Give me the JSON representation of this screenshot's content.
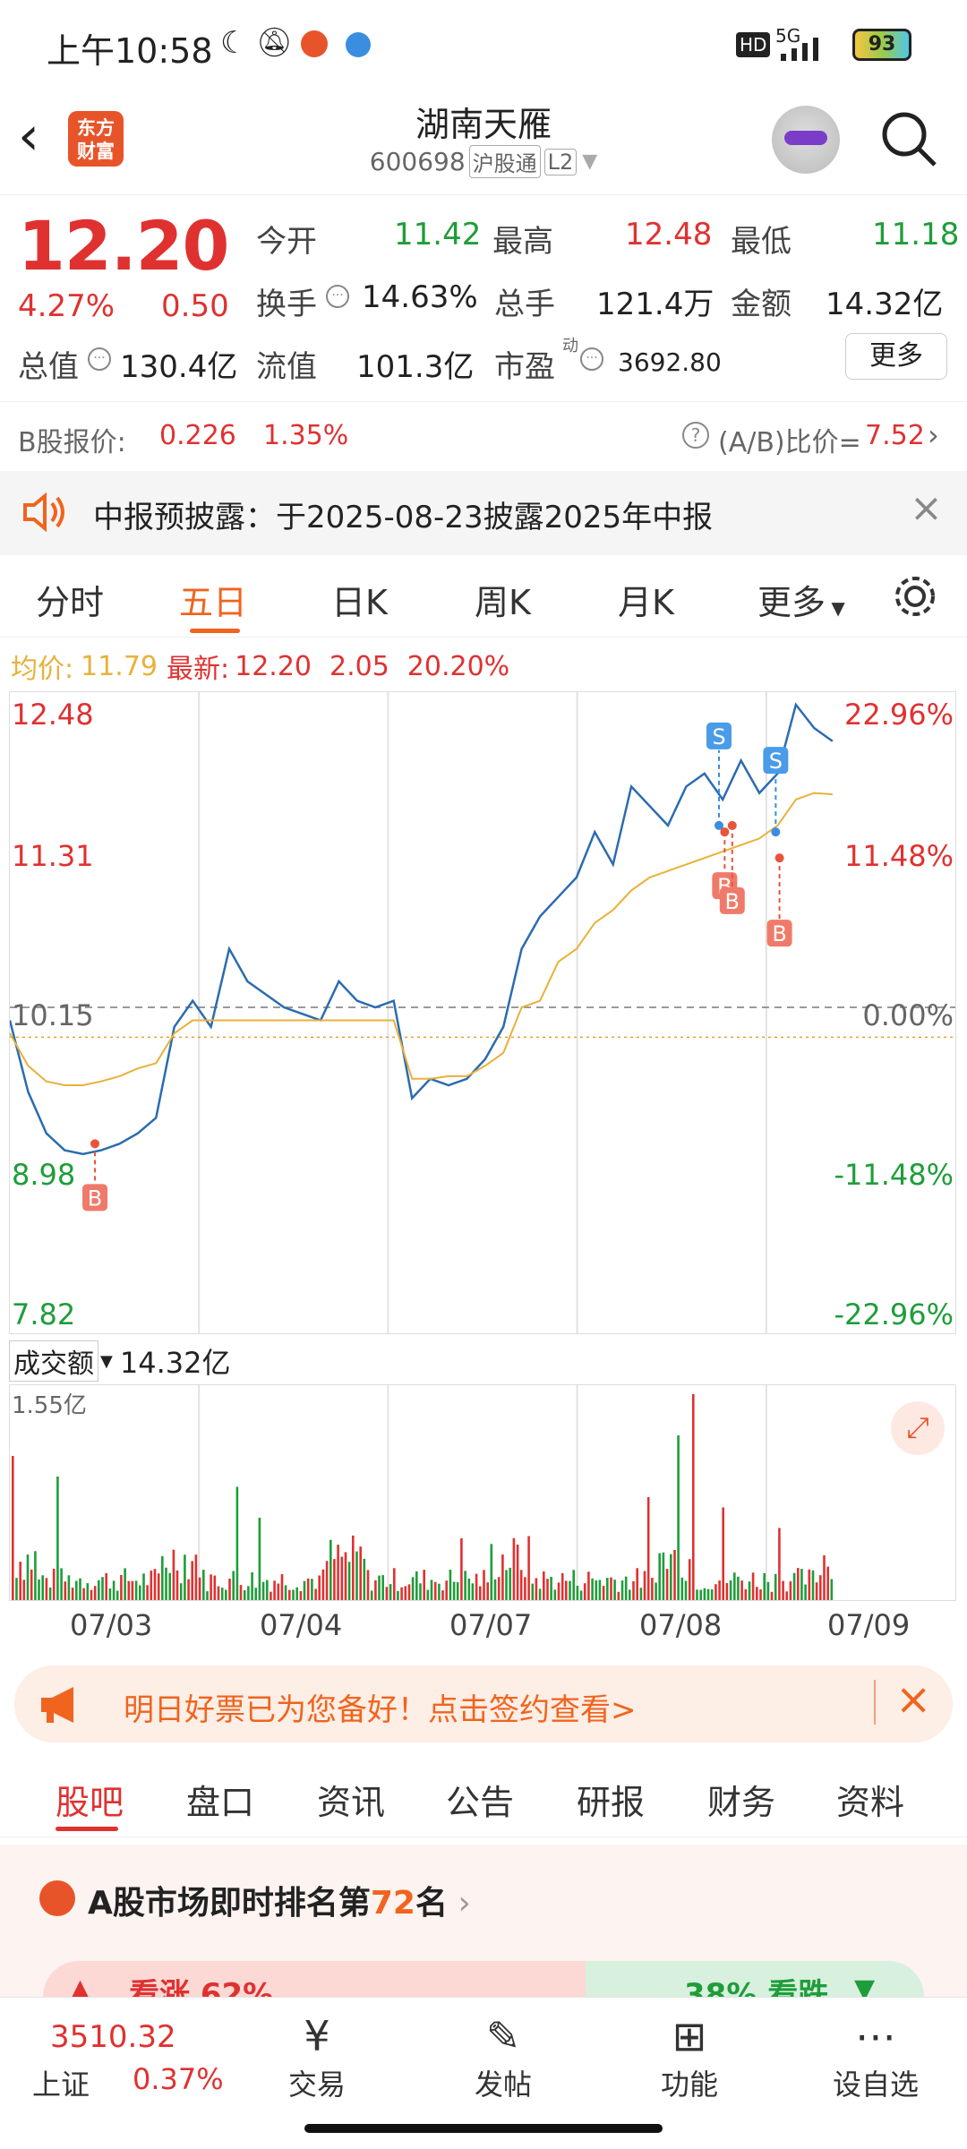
{
  "status_bar": {
    "time": "上午10:58",
    "network": "5G",
    "battery": "93"
  },
  "header": {
    "app_logo_text": "东方财富",
    "stock_name": "湖南天雁",
    "stock_code": "600698",
    "tag_hgt": "沪股通",
    "tag_l2": "L2"
  },
  "quote": {
    "price": "12.20",
    "change_pct": "4.27%",
    "change": "0.50",
    "fields": {
      "open_label": "今开",
      "open": "11.42",
      "high_label": "最高",
      "high": "12.48",
      "low_label": "最低",
      "low": "11.18",
      "turnover_label": "换手",
      "turnover": "14.63%",
      "volume_label": "总手",
      "volume": "121.4万",
      "amount_label": "金额",
      "amount": "14.32亿",
      "mktcap_label": "总值",
      "mktcap": "130.4亿",
      "float_label": "流值",
      "float": "101.3亿",
      "pe_label": "市盈",
      "pe_sup": "动",
      "pe": "3692.80"
    },
    "more_label": "更多"
  },
  "b_share": {
    "label": "B股报价:",
    "price": "0.226",
    "pct": "1.35%",
    "ratio_label": "(A/B)比价=",
    "ratio": "7.52"
  },
  "notice": {
    "text": "中报预披露：于2025-08-23披露2025年中报"
  },
  "chart_tabs": [
    "分时",
    "五日",
    "日K",
    "周K",
    "月K",
    "更多"
  ],
  "legend": {
    "avg_label": "均价:",
    "avg": "11.79",
    "latest_label": "最新:",
    "latest": "12.20",
    "chg": "2.05",
    "chg_pct": "20.20%"
  },
  "chart_data": {
    "type": "line",
    "title": "",
    "x": [
      "07/03",
      "07/04",
      "07/07",
      "07/08",
      "07/09"
    ],
    "ylim": [
      7.82,
      12.48
    ],
    "y_ticks_left": [
      "12.48",
      "11.31",
      "10.15",
      "8.98",
      "7.82"
    ],
    "y_ticks_right": [
      "22.96%",
      "11.48%",
      "0.00%",
      "-11.48%",
      "-22.96%"
    ],
    "series": [
      {
        "name": "",
        "color": "#2b6cb0",
        "values": [
          10.05,
          9.5,
          9.18,
          9.05,
          9.02,
          9.05,
          9.1,
          9.18,
          9.3,
          10.0,
          10.2,
          10.0,
          10.6,
          10.35,
          10.25,
          10.15,
          10.1,
          10.05,
          10.35,
          10.2,
          10.15,
          10.2,
          9.45,
          9.6,
          9.55,
          9.6,
          9.75,
          10.0,
          10.6,
          10.85,
          11.0,
          11.15,
          11.5,
          11.25,
          11.85,
          11.7,
          11.55,
          11.85,
          11.95,
          11.75,
          12.05,
          11.8,
          11.95,
          12.48,
          12.3,
          12.2
        ]
      },
      {
        "name": "",
        "color": "#e8b13a",
        "values": [
          9.95,
          9.7,
          9.58,
          9.55,
          9.55,
          9.58,
          9.62,
          9.68,
          9.72,
          9.95,
          10.05,
          10.05,
          10.05,
          10.05,
          10.05,
          10.05,
          10.05,
          10.05,
          10.05,
          10.05,
          10.05,
          10.05,
          9.6,
          9.6,
          9.62,
          9.62,
          9.7,
          9.8,
          10.15,
          10.2,
          10.5,
          10.6,
          10.8,
          10.9,
          11.05,
          11.15,
          11.2,
          11.25,
          11.3,
          11.35,
          11.4,
          11.45,
          11.55,
          11.75,
          11.8,
          11.79
        ]
      }
    ],
    "markers": [
      {
        "label": "B",
        "day": "07/03",
        "price": 9.1
      },
      {
        "label": "S",
        "day": "07/08",
        "price": 11.55
      },
      {
        "label": "B",
        "day": "07/08",
        "price": 11.5
      },
      {
        "label": "B",
        "day": "07/08",
        "price": 11.55
      },
      {
        "label": "S",
        "day": "07/09",
        "price": 11.5
      },
      {
        "label": "B",
        "day": "07/09",
        "price": 11.3
      }
    ]
  },
  "volume": {
    "label": "成交额",
    "value": "14.32亿",
    "max_label": "1.55亿"
  },
  "dates": [
    "07/03",
    "07/04",
    "07/07",
    "07/08",
    "07/09"
  ],
  "promo": {
    "text": "明日好票已为您备好！点击签约查看>"
  },
  "sub_tabs": [
    "股吧",
    "盘口",
    "资讯",
    "公告",
    "研报",
    "财务",
    "资料"
  ],
  "rank": {
    "title_pre": "A股市场即时排名第",
    "rank_num": "72",
    "title_post": "名",
    "up_label": "看涨 62%",
    "down_label": "38% 看跌"
  },
  "bottom_nav": {
    "index_value": "3510.32",
    "index_name": "上证",
    "index_pct": "0.37%",
    "items": [
      "交易",
      "发帖",
      "功能",
      "设自选"
    ]
  }
}
